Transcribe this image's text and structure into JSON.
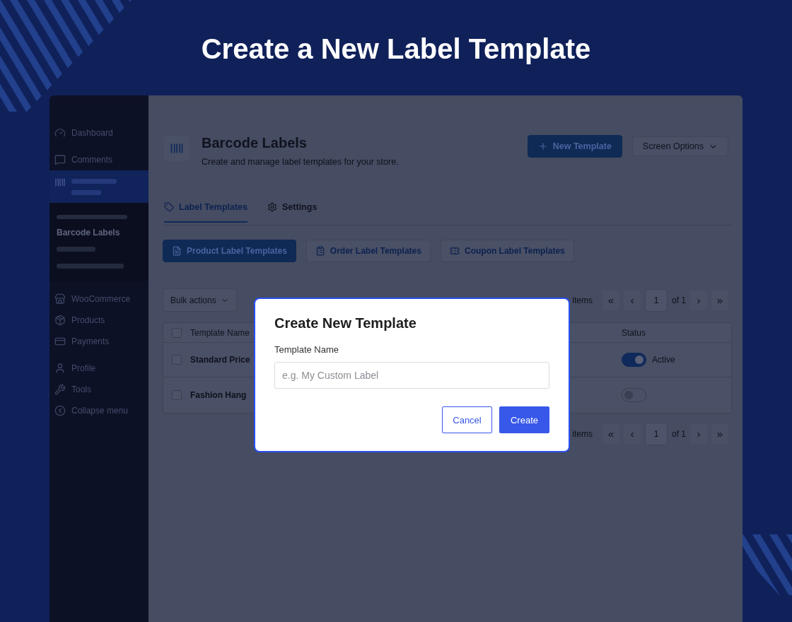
{
  "page": {
    "title": "Create a New Label Template"
  },
  "sidebar": {
    "items": [
      {
        "kind": "link",
        "label": "Dashboard",
        "selected": false
      },
      {
        "kind": "separator"
      },
      {
        "kind": "link",
        "label": "Comments",
        "selected": false
      },
      {
        "kind": "link",
        "selected": true,
        "children": [
          {
            "kind": "heading"
          },
          {
            "kind": "link",
            "label": "Barcode Labels",
            "selected": true
          },
          {
            "kind": "link",
            "selected": false
          },
          {
            "kind": "link",
            "selected": false
          }
        ]
      },
      {
        "kind": "link",
        "label": "WooCommerce",
        "selected": false
      },
      {
        "kind": "link",
        "label": "Products",
        "selected": false
      },
      {
        "kind": "link",
        "label": "Payments",
        "selected": false
      },
      {
        "kind": "separator"
      },
      {
        "kind": "link",
        "label": "Profile",
        "selected": false
      },
      {
        "kind": "link",
        "label": "Tools",
        "selected": false
      },
      {
        "kind": "link",
        "label": "Collapse menu",
        "selected": false
      }
    ]
  },
  "header": {
    "title": "Barcode Labels",
    "subtitle": "Create and manage label templates for your store."
  },
  "actions": [
    {
      "kind": "primary",
      "label": "New Template"
    },
    {
      "kind": "dropdown",
      "label": "Screen Options"
    }
  ],
  "tabs": [
    {
      "label": "Label Templates",
      "selected": true
    },
    {
      "label": "Settings",
      "selected": false
    }
  ],
  "template_types": [
    {
      "label": "Product Label Templates",
      "selected": true
    },
    {
      "label": "Order Label Templates",
      "selected": false
    },
    {
      "label": "Coupon Label Templates",
      "selected": false
    }
  ],
  "toolbar": {
    "bulk_actions": "Bulk actions",
    "pager": {
      "count": "items",
      "first": "«",
      "prev": "‹",
      "page": "1",
      "total": "of 1",
      "next": "›",
      "last": "»"
    }
  },
  "table": {
    "all_checked": false,
    "columns": [
      "Template Name",
      "Status"
    ],
    "rows": [
      {
        "checked": false,
        "name": "Standard Price",
        "on": true,
        "status": "Active"
      },
      {
        "checked": false,
        "name": "Fashion Hang",
        "on": false
      }
    ]
  },
  "footer_pager": {
    "count": "items",
    "first": "«",
    "prev": "‹",
    "page": "1",
    "total": "of 1",
    "next": "›",
    "last": "»"
  },
  "modal": {
    "title": "Create New Template",
    "field_label": "Template Name",
    "placeholder": "e.g. My Custom Label",
    "buttons": [
      {
        "kind": "secondary",
        "label": "Cancel"
      },
      {
        "kind": "primary",
        "label": "Create"
      }
    ]
  }
}
